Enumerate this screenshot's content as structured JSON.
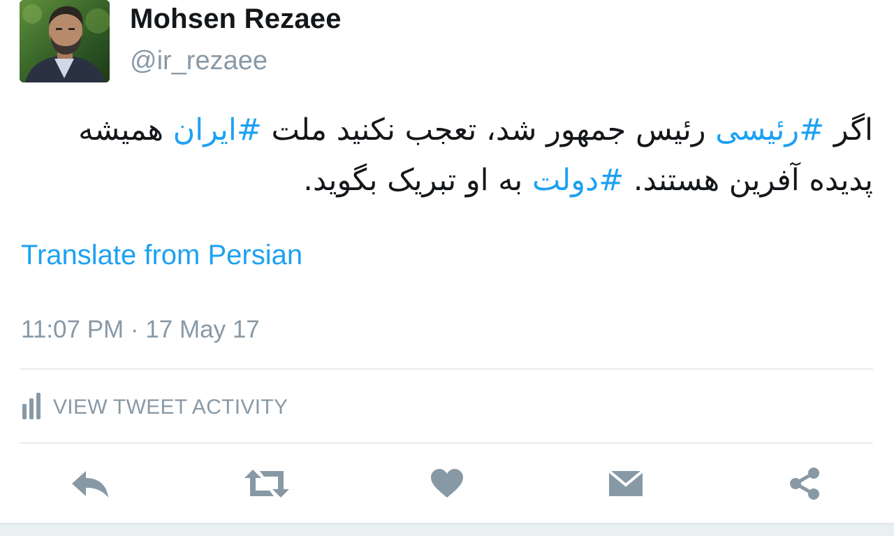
{
  "author": {
    "display_name": "Mohsen Rezaee",
    "handle": "@ir_rezaee"
  },
  "tweet": {
    "segments": [
      {
        "text": "اگر ",
        "type": "text"
      },
      {
        "text": "#رئیسی",
        "type": "hashtag"
      },
      {
        "text": " رئیس جمهور شد، تعجب نکنید ملت ",
        "type": "text"
      },
      {
        "text": "#ایران",
        "type": "hashtag"
      },
      {
        "text": " همیشه پدیده آفرین هستند. ",
        "type": "text"
      },
      {
        "text": "#دولت",
        "type": "hashtag"
      },
      {
        "text": " به او تبریک بگوید.",
        "type": "text"
      }
    ],
    "translate_label": "Translate from Persian",
    "timestamp": "11:07 PM · 17 May 17"
  },
  "activity": {
    "label": "VIEW TWEET ACTIVITY",
    "icon": "bar-chart-icon"
  },
  "actions": [
    {
      "name": "reply-button",
      "icon": "reply-icon"
    },
    {
      "name": "retweet-button",
      "icon": "retweet-icon"
    },
    {
      "name": "like-button",
      "icon": "heart-icon"
    },
    {
      "name": "direct-message-button",
      "icon": "envelope-icon"
    },
    {
      "name": "share-button",
      "icon": "share-icon"
    }
  ],
  "colors": {
    "link": "#1da1f2",
    "text": "#14171a",
    "muted": "#8899a6",
    "icon": "#8899a6"
  }
}
